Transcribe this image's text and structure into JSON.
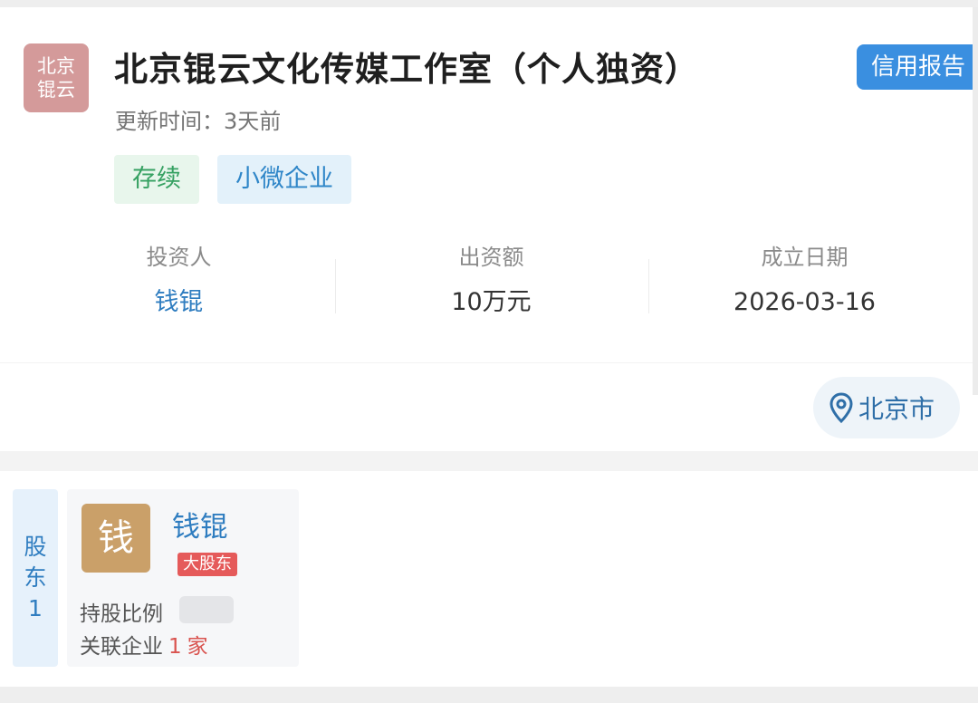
{
  "company": {
    "logo_line1": "北京",
    "logo_line2": "锟云",
    "name": "北京锟云文化传媒工作室（个人独资）",
    "credit_report": "信用报告",
    "update_time": "更新时间：3天前",
    "tags": [
      "存续",
      "小微企业"
    ],
    "info": [
      {
        "label": "投资人",
        "value": "钱锟"
      },
      {
        "label": "出资额",
        "value": "10万元"
      },
      {
        "label": "成立日期",
        "value": "2026-03-16"
      }
    ],
    "location": "北京市"
  },
  "shareholder": {
    "section_line1": "股",
    "section_line2": "东",
    "section_count": "1",
    "avatar_char": "钱",
    "name": "钱锟",
    "badge": "大股东",
    "ratio_label": "持股比例",
    "related_label": "关联企业",
    "related_count": "1",
    "related_unit": "家"
  },
  "colors": {
    "accent_blue": "#3a8fe0",
    "status_green": "#36a162",
    "badge_red": "#e55a5a",
    "logo_pink": "#d49a9a",
    "avatar_gold": "#caa069"
  },
  "icons": {
    "location": "location-pin-icon"
  }
}
